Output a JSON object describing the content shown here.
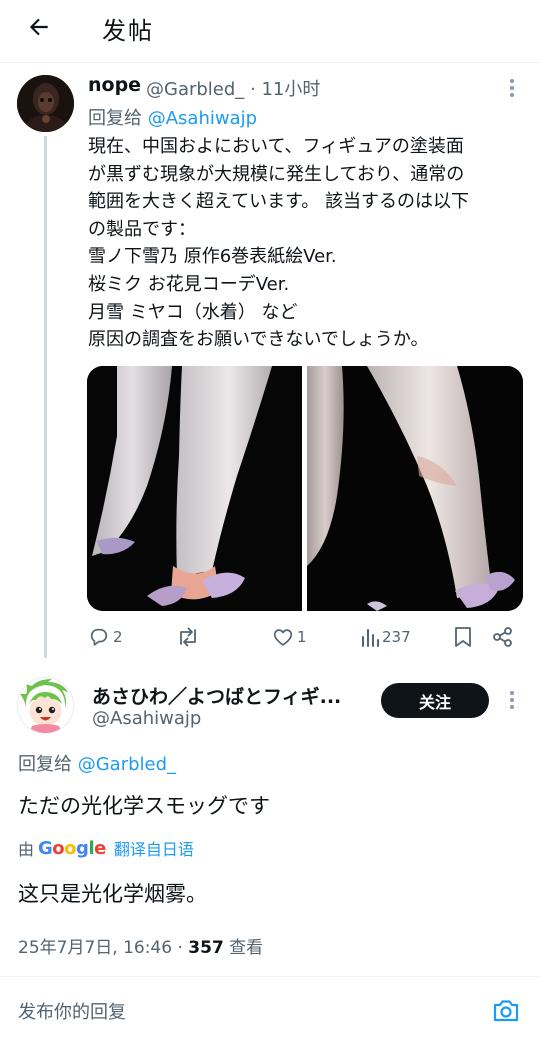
{
  "header": {
    "title": "发帖"
  },
  "parent_tweet": {
    "name": "nope",
    "handle_time": "@Garbled_ · 11小时",
    "reply_prefix": "回复给",
    "reply_to": "@Asahiwajp",
    "text_lines": [
      "現在、中国およにおいて、フィギュアの塗装面",
      "が黒ずむ現象が大規模に発生しており、通常の",
      "範囲を大きく超えています。 該当するのは以下",
      "の製品です：",
      "雪ノ下雪乃 原作6巻表紙絵Ver.",
      "桜ミク お花見コーデVer.",
      "月雪 ミヤコ（水着） など",
      "原因の調査をお願いできないでしょうか。"
    ],
    "stats": {
      "replies": "2",
      "retweets": "",
      "likes": "1",
      "views": "237"
    }
  },
  "main_tweet": {
    "name": "あさひわ／よつばとフィギ...",
    "handle": "@Asahiwajp",
    "follow_label": "关注",
    "reply_prefix": "回复给",
    "reply_to": "@Garbled_",
    "text": "ただの光化学スモッグです",
    "translate_by": "由",
    "translate_logo": "Google",
    "translate_action": "翻译自日语",
    "translated_text": "这只是光化学烟雾。",
    "timestamp": "25年7月7日, 16:46 · ",
    "views_count": "357",
    "views_label": " 查看"
  },
  "compose": {
    "placeholder": "发布你的回复"
  },
  "colors": {
    "accent": "#1d9bf0",
    "text": "#0f1419",
    "muted": "#536471",
    "divider": "#eff3f4",
    "thread_line": "#cfd9de"
  },
  "icons": [
    "back-arrow-icon",
    "more-vertical-icon",
    "reply-icon",
    "retweet-icon",
    "like-icon",
    "views-icon",
    "bookmark-icon",
    "share-icon",
    "camera-icon"
  ]
}
